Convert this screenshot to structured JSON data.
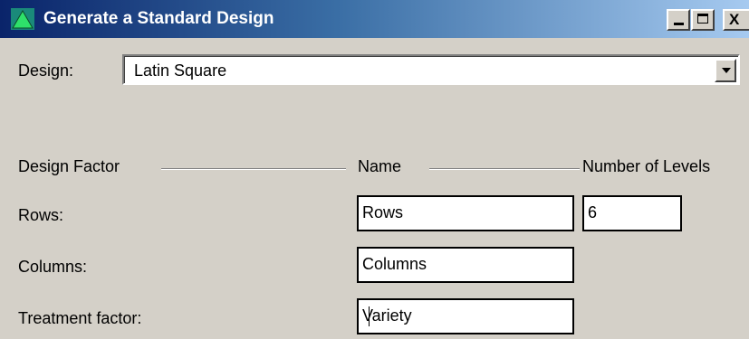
{
  "window": {
    "title": "Generate a Standard Design",
    "icon": "triangle-app-icon",
    "controls": {
      "close_glyph": "X"
    }
  },
  "design": {
    "label": "Design:",
    "selected": "Latin Square"
  },
  "headers": {
    "factor": "Design Factor",
    "name": "Name",
    "levels": "Number of Levels"
  },
  "factors": [
    {
      "label": "Rows:",
      "name": "Rows",
      "levels": "6"
    },
    {
      "label": "Columns:",
      "name": "Columns"
    },
    {
      "label": "Treatment factor:",
      "name": "Variety"
    }
  ],
  "colors": {
    "titlebar_start": "#0a246a",
    "titlebar_end": "#a6caf0",
    "dialog_bg": "#d4d0c8"
  }
}
